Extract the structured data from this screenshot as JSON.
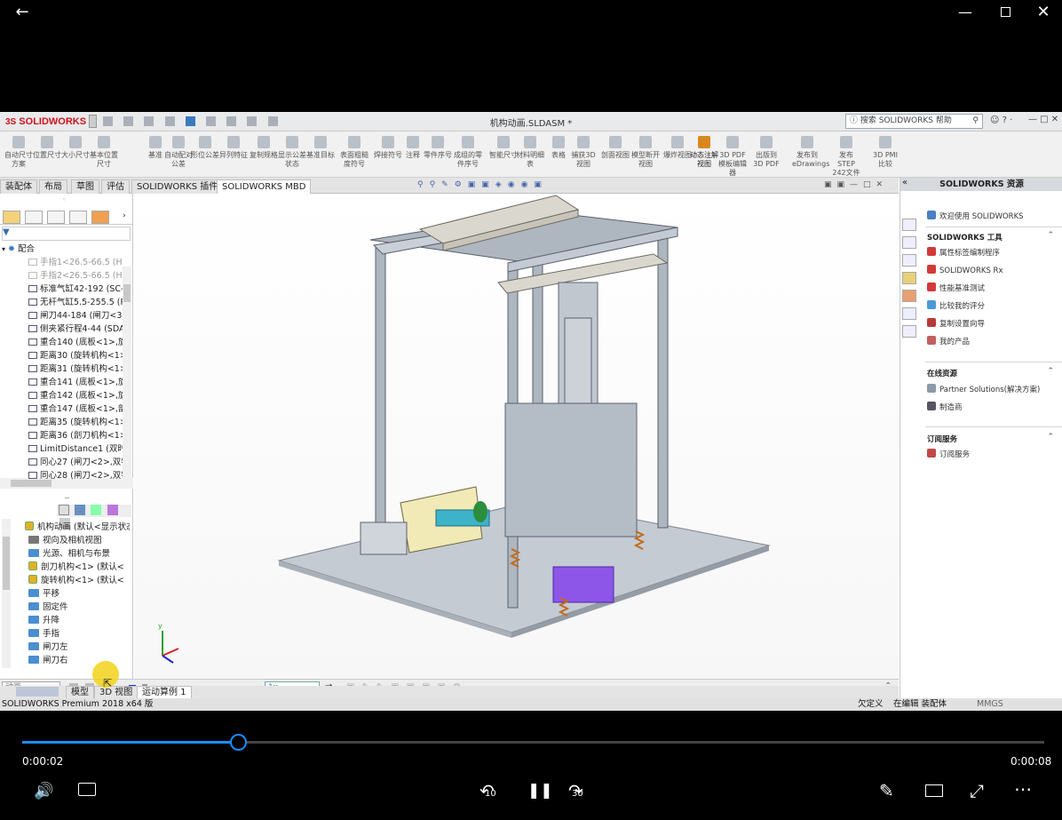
{
  "window": {
    "title": "机构动画.SLDASM *",
    "logo": "SOLIDWORKS",
    "search_placeholder": "搜索 SOLIDWORKS 帮助"
  },
  "command_buttons": [
    {
      "label": "自动尺寸方案"
    },
    {
      "label": "位置尺寸"
    },
    {
      "label": "大小尺寸"
    },
    {
      "label": "基本位置尺寸"
    },
    {
      "label": "基准"
    },
    {
      "label": "自动配对公差"
    },
    {
      "label": "形位公差"
    },
    {
      "label": "异列特征"
    },
    {
      "label": "复制规格"
    },
    {
      "label": "显示公差状态"
    },
    {
      "label": "基准目标"
    },
    {
      "label": "表面粗糙度符号"
    },
    {
      "label": "焊接符号"
    },
    {
      "label": "注释"
    },
    {
      "label": "零件序号"
    },
    {
      "label": "成组的零件序号"
    },
    {
      "label": "智能尺寸"
    },
    {
      "label": "材料明细表"
    },
    {
      "label": "表格"
    },
    {
      "label": "捕获3D视图"
    },
    {
      "label": "剖面视图"
    },
    {
      "label": "模型断开视图"
    },
    {
      "label": "爆炸视图"
    },
    {
      "label": "动态注解视图"
    },
    {
      "label": "3D PDF模板编辑器"
    },
    {
      "label": "出版到3D PDF"
    },
    {
      "label": "发布到eDrawings"
    },
    {
      "label": "发布STEP 242文件"
    },
    {
      "label": "3D PMI比较"
    }
  ],
  "tabs": [
    {
      "label": "装配体"
    },
    {
      "label": "布局"
    },
    {
      "label": "草图"
    },
    {
      "label": "评估"
    },
    {
      "label": "SOLIDWORKS 插件"
    },
    {
      "label": "SOLIDWORKS MBD"
    }
  ],
  "mates_tree": {
    "root": "配合",
    "items": [
      {
        "label": "手指1<26.5-66.5 (HF",
        "dim": true
      },
      {
        "label": "手指2<26.5-66.5 (HF",
        "dim": true
      },
      {
        "label": "标准气缸42-192 (SC-",
        "dim": false
      },
      {
        "label": "无杆气缸5.5-255.5 (R",
        "dim": false
      },
      {
        "label": "闸刀44-184 (闸刀<3>",
        "dim": false
      },
      {
        "label": "侧夹紧行程4-44 (SDA",
        "dim": false
      },
      {
        "label": "重合140 (底板<1>,旋",
        "dim": false
      },
      {
        "label": "距离30 (旋转机构<1>",
        "dim": false
      },
      {
        "label": "距离31 (旋转机构<1>",
        "dim": false
      },
      {
        "label": "重合141 (底板<1>,旋",
        "dim": false
      },
      {
        "label": "重合142 (底板<1>,旋",
        "dim": false
      },
      {
        "label": "重合147 (底板<1>,剖",
        "dim": false
      },
      {
        "label": "距离35 (旋转机构<1>",
        "dim": false
      },
      {
        "label": "距离36 (剖刀机构<1>",
        "dim": false
      },
      {
        "label": "LimitDistance1 (双时",
        "dim": false
      },
      {
        "label": "同心27 (闸刀<2>,双特",
        "dim": false
      },
      {
        "label": "同心28 (闸刀<2>,双特",
        "dim": false
      }
    ]
  },
  "motion_tree": {
    "items": [
      {
        "label": "机构动画 (默认<显示状态",
        "kind": "asm"
      },
      {
        "label": "视向及相机视图",
        "kind": "cam"
      },
      {
        "label": "光源、相机与布景",
        "kind": "fold"
      },
      {
        "label": "剖刀机构<1> (默认<",
        "kind": "asm"
      },
      {
        "label": "旋转机构<1> (默认<",
        "kind": "asm"
      },
      {
        "label": "平移",
        "kind": "fold"
      },
      {
        "label": "固定件",
        "kind": "fold"
      },
      {
        "label": "升降",
        "kind": "fold"
      },
      {
        "label": "手指",
        "kind": "fold"
      },
      {
        "label": "闸刀左",
        "kind": "fold"
      },
      {
        "label": "闸刀右",
        "kind": "fold"
      }
    ]
  },
  "right_panel": {
    "title": "SOLIDWORKS 资源",
    "welcome": "欢迎使用 SOLIDWORKS",
    "tools_title": "SOLIDWORKS 工具",
    "tools": [
      {
        "label": "属性标签编制程序"
      },
      {
        "label": "SOLIDWORKS Rx"
      },
      {
        "label": "性能基准测试"
      },
      {
        "label": "比较我的评分"
      },
      {
        "label": "复制设置向导"
      },
      {
        "label": "我的产品"
      }
    ],
    "online_title": "在线资源",
    "online": [
      {
        "label": "Partner Solutions(解决方案)"
      },
      {
        "label": "制造商"
      }
    ],
    "sub_title": "订阅服务",
    "sub": [
      {
        "label": "订阅服务"
      }
    ]
  },
  "bottom": {
    "study_type": "动画",
    "speed": "1x",
    "tabs": [
      {
        "label": "模型"
      },
      {
        "label": "3D 视图"
      },
      {
        "label": "运动算例 1"
      }
    ]
  },
  "status": {
    "product": "SOLIDWORKS Premium 2018 x64 版",
    "state": "欠定义",
    "mode": "在编辑 装配体",
    "units": "MMGS"
  },
  "player": {
    "current_time": "0:00:02",
    "total_time": "0:00:08",
    "progress": 0.211,
    "skip_back": "10",
    "skip_fwd": "30"
  },
  "colors": {
    "accent": "#1a8cff",
    "logo_red": "#d0121b"
  }
}
